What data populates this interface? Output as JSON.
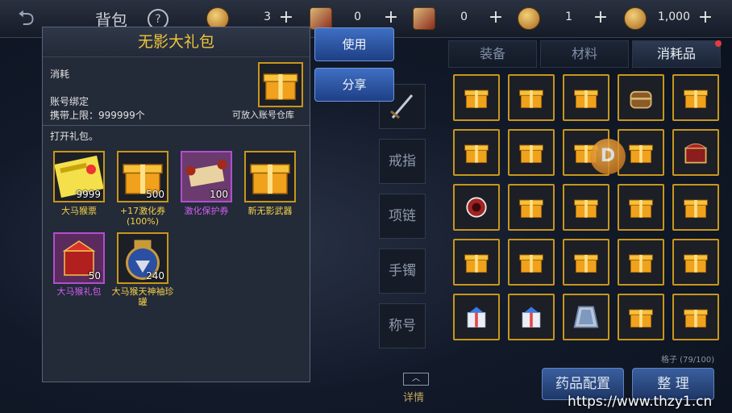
{
  "header": {
    "title": "背包",
    "help": "?",
    "currencies": [
      {
        "icon": "gold-coin-icon",
        "value": "3"
      },
      {
        "icon": "red-badge-icon",
        "value": "0"
      },
      {
        "icon": "scroll-ticket-icon",
        "value": "0"
      },
      {
        "icon": "bronze-coin-icon",
        "value": "1"
      },
      {
        "icon": "gold-ingot-icon",
        "value": "1,000"
      }
    ]
  },
  "tabs": [
    "装备",
    "材料",
    "消耗品"
  ],
  "grid": {
    "items": [
      "gift-box-icon",
      "gift-box-icon",
      "gift-box-icon",
      "treasure-chest-icon",
      "gift-box-icon",
      "gift-box-icon",
      "gift-box-icon",
      "gift-box-icon",
      "gift-box-icon",
      "red-chest-icon",
      "red-orb-icon",
      "gift-box-icon",
      "gift-box-icon",
      "gift-box-icon",
      "gift-box-icon",
      "gift-box-icon",
      "gift-box-icon",
      "gift-box-icon",
      "gift-box-icon",
      "gift-box-icon",
      "ribbon-gift-icon",
      "ribbon-gift-icon",
      "blue-cloak-icon",
      "gift-box-icon",
      "gift-box-icon"
    ],
    "capacity": "格子 (79/100)"
  },
  "buttons": {
    "potion_config": "药品配置",
    "sort": "整 理",
    "use": "使用",
    "share": "分享"
  },
  "slots": [
    "戒指",
    "项链",
    "手镯",
    "称号"
  ],
  "detail": "详情",
  "popup": {
    "title": "无影大礼包",
    "category": "消耗",
    "bind": "账号绑定",
    "carry_limit": "携带上限：999999个",
    "store_note": "可放入账号仓库",
    "open_note": "打开礼包。",
    "rewards": [
      {
        "name": "大马猴票",
        "count": "9999",
        "icon": "ticket-icon",
        "rarity": "gold"
      },
      {
        "name": "+17激化券(100%)",
        "count": "500",
        "icon": "gift-box-icon",
        "rarity": "gold"
      },
      {
        "name": "激化保护券",
        "count": "100",
        "icon": "scroll-icon",
        "rarity": "purple"
      },
      {
        "name": "新无影武器",
        "count": "",
        "icon": "gift-box-icon",
        "rarity": "gold"
      },
      {
        "name": "大马猴礼包",
        "count": "50",
        "icon": "red-gift-box-icon",
        "rarity": "purple"
      },
      {
        "name": "大马猴天神袖珍罐",
        "count": "240",
        "icon": "jar-icon",
        "rarity": "gold"
      }
    ]
  },
  "watermark": "https://www.thzy1.cn"
}
